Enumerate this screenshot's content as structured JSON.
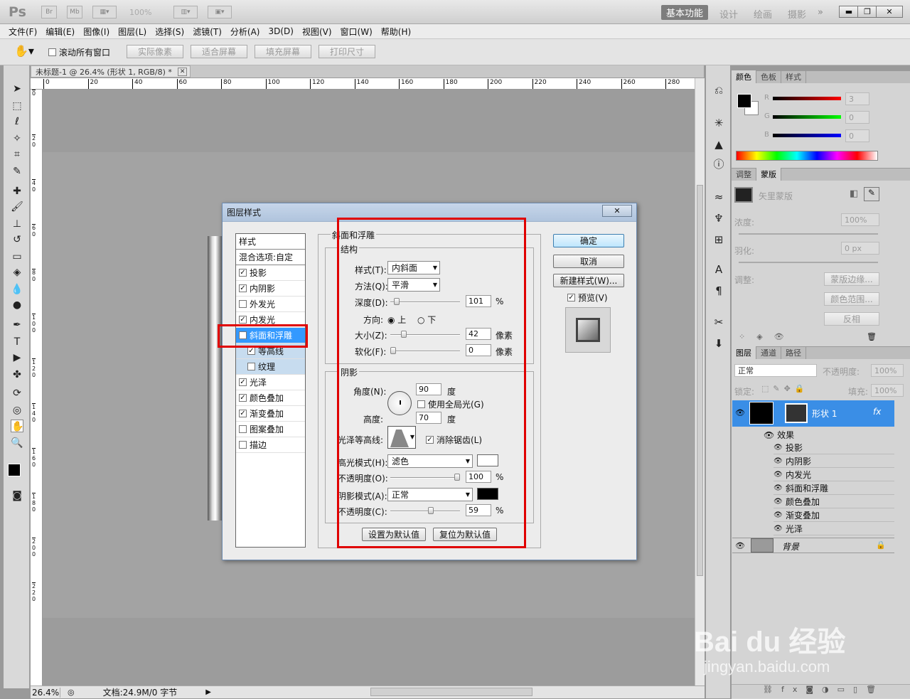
{
  "app": {
    "logo": "Ps",
    "workspace_active": "基本功能",
    "workspaces": [
      "设计",
      "绘画",
      "摄影"
    ],
    "zoom": "100%",
    "more": "»"
  },
  "menu": [
    "文件(F)",
    "编辑(E)",
    "图像(I)",
    "图层(L)",
    "选择(S)",
    "滤镜(T)",
    "分析(A)",
    "3D(D)",
    "视图(V)",
    "窗口(W)",
    "帮助(H)"
  ],
  "options": {
    "scroll_all": "滚动所有窗口",
    "actual_pixels": "实际像素",
    "fit_screen": "适合屏幕",
    "fill_screen": "填充屏幕",
    "print_size": "打印尺寸"
  },
  "document": {
    "tab_title": "未标题-1 @ 26.4% (形状 1, RGB/8) *",
    "zoom": "26.4%",
    "doc_info": "文档:24.9M/0 字节",
    "ruler_h": [
      "0",
      "20",
      "40",
      "60",
      "80",
      "100",
      "120",
      "140",
      "160",
      "180",
      "200",
      "220",
      "240",
      "260",
      "280"
    ],
    "ruler_v": [
      "0",
      "2\n0",
      "4\n0",
      "6\n0",
      "8\n0",
      "1\n0\n0",
      "1\n2\n0",
      "1\n4\n0",
      "1\n6\n0",
      "1\n8\n0",
      "2\n0\n0",
      "2\n2\n0"
    ]
  },
  "dialog": {
    "title": "图层样式",
    "close": "✕",
    "styles_header": "样式",
    "blend_options": "混合选项:自定",
    "styles": [
      {
        "label": "投影",
        "checked": true
      },
      {
        "label": "内阴影",
        "checked": true
      },
      {
        "label": "外发光",
        "checked": false
      },
      {
        "label": "内发光",
        "checked": true
      },
      {
        "label": "斜面和浮雕",
        "checked": true,
        "selected": true
      },
      {
        "label": "等高线",
        "checked": true,
        "sub": true
      },
      {
        "label": "纹理",
        "checked": false,
        "sub": true
      },
      {
        "label": "光泽",
        "checked": true
      },
      {
        "label": "颜色叠加",
        "checked": true
      },
      {
        "label": "渐变叠加",
        "checked": true
      },
      {
        "label": "图案叠加",
        "checked": false
      },
      {
        "label": "描边",
        "checked": false
      }
    ],
    "section_title": "斜面和浮雕",
    "structure": "结构",
    "style_label": "样式(T):",
    "style_value": "内斜面",
    "technique_label": "方法(Q):",
    "technique_value": "平滑",
    "depth_label": "深度(D):",
    "depth_value": "101",
    "depth_unit": "%",
    "depth_level": 0.05,
    "direction_label": "方向:",
    "dir_up": "上",
    "dir_down": "下",
    "size_label": "大小(Z):",
    "size_value": "42",
    "size_unit": "像素",
    "size_level": 0.17,
    "soften_label": "软化(F):",
    "soften_value": "0",
    "soften_unit": "像素",
    "soften_level": 0,
    "shading": "阴影",
    "angle_label": "角度(N):",
    "angle_value": "90",
    "angle_unit": "度",
    "global_light": "使用全局光(G)",
    "altitude_label": "高度:",
    "altitude_value": "70",
    "altitude_unit": "度",
    "gloss_label": "光泽等高线:",
    "antialias": "消除锯齿(L)",
    "highlight_label": "高光模式(H):",
    "highlight_value": "滤色",
    "highlight_color": "#ffffff",
    "opacity1_label": "不透明度(O):",
    "opacity1_value": "100",
    "opacity1_level": 1.0,
    "shadow_label": "阴影模式(A):",
    "shadow_value": "正常",
    "shadow_color": "#000000",
    "opacity2_label": "不透明度(C):",
    "opacity2_value": "59",
    "opacity2_level": 0.59,
    "pct": "%",
    "set_default": "设置为默认值",
    "reset_default": "复位为默认值",
    "ok": "确定",
    "cancel": "取消",
    "new_style": "新建样式(W)...",
    "preview": "预览(V)"
  },
  "color_panel": {
    "tabs": [
      "颜色",
      "色板",
      "样式"
    ],
    "r_label": "R",
    "g_label": "G",
    "b_label": "B",
    "r": "3",
    "g": "0",
    "b": "0"
  },
  "masks_panel": {
    "tabs": [
      "调整",
      "蒙版"
    ],
    "vector_mask": "矢里蒙版",
    "density": "浓度:",
    "density_val": "100%",
    "feather": "羽化:",
    "feather_val": "0 px",
    "refine": "调整:",
    "mask_edge": "蒙版边缘...",
    "color_range": "颜色范围...",
    "invert": "反相"
  },
  "layers_panel": {
    "tabs": [
      "图层",
      "通道",
      "路径"
    ],
    "blend": "正常",
    "opacity_label": "不透明度:",
    "opacity": "100%",
    "lock_label": "锁定:",
    "fill_label": "填充:",
    "fill": "100%",
    "layer_name": "形状 1",
    "fx": "fx",
    "effects_label": "效果",
    "effects": [
      "投影",
      "内阴影",
      "内发光",
      "斜面和浮雕",
      "颜色叠加",
      "渐变叠加",
      "光泽"
    ],
    "background": "背景"
  },
  "watermark": {
    "brand": "Bai du 经验",
    "url": "jingyan.baidu.com"
  }
}
